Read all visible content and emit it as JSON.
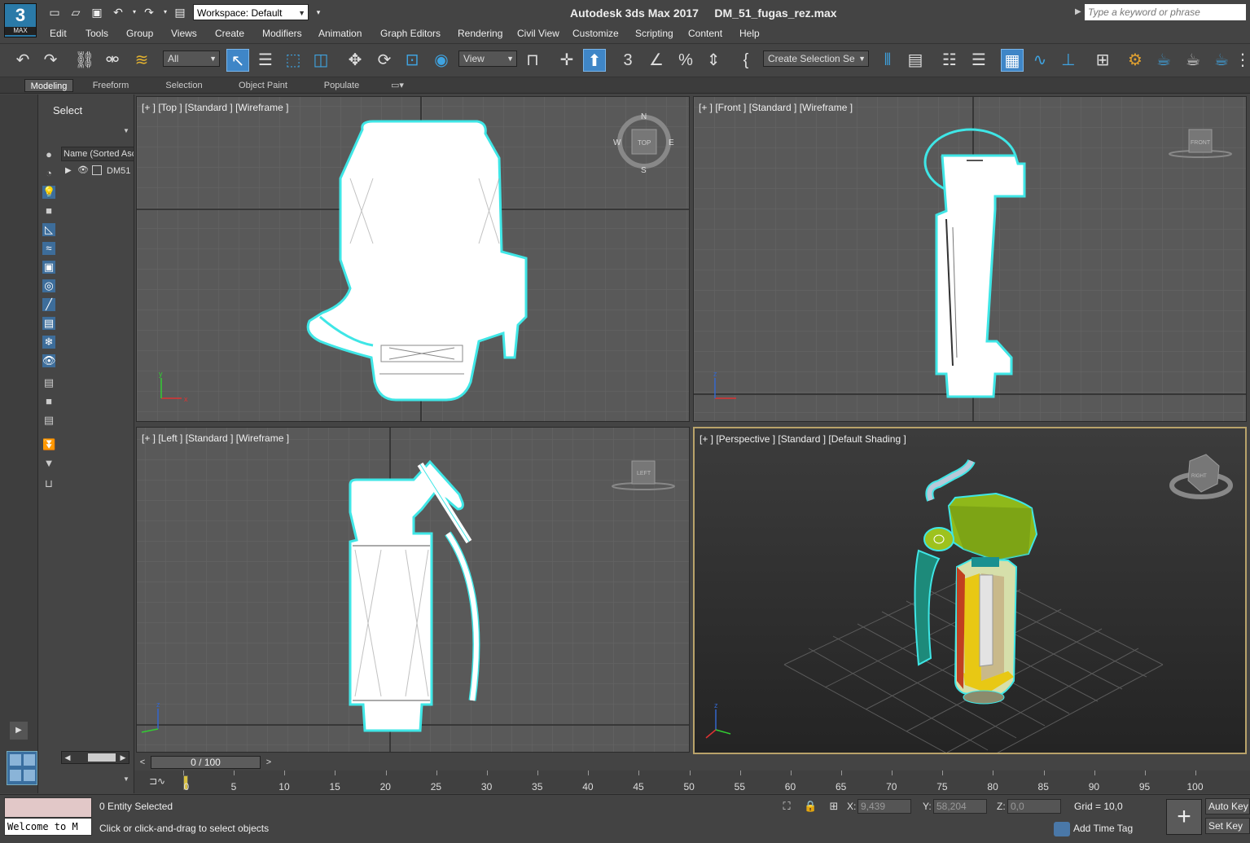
{
  "app": {
    "logo_number": "3",
    "logo_caption": "MAX",
    "title": "Autodesk 3ds Max 2017     DM_51_fugas_rez.max",
    "workspace": "Workspace: Default",
    "search_placeholder": "Type a keyword or phrase"
  },
  "menu": [
    "Edit",
    "Tools",
    "Group",
    "Views",
    "Create",
    "Modifiers",
    "Animation",
    "Graph Editors",
    "Rendering",
    "Civil View",
    "Customize",
    "Scripting",
    "Content",
    "Help"
  ],
  "toolbar": {
    "filter": "All",
    "reference_coord": "View",
    "selection_set": "Create Selection Se"
  },
  "ribbon_tabs": [
    "Modeling",
    "Freeform",
    "Selection",
    "Object Paint",
    "Populate"
  ],
  "explorer": {
    "title": "Select",
    "column_header": "Name (Sorted Asc",
    "row": "DM51"
  },
  "viewports": {
    "top": "[+ ] [Top ] [Standard ] [Wireframe ]",
    "front": "[+ ] [Front ] [Standard ] [Wireframe ]",
    "left": "[+ ] [Left ] [Standard ] [Wireframe ]",
    "perspective": "[+ ] [Perspective ] [Standard ] [Default Shading ]",
    "compass_n": "N",
    "compass_s": "S",
    "compass_w": "W",
    "compass_e": "E",
    "cube_top": "TOP",
    "cube_front": "FRONT",
    "cube_left": "LEFT",
    "cube_right": "RIGHT"
  },
  "timeline": {
    "frame": "0 / 100",
    "ticks": [
      "0",
      "5",
      "10",
      "15",
      "20",
      "25",
      "30",
      "35",
      "40",
      "45",
      "50",
      "55",
      "60",
      "65",
      "70",
      "75",
      "80",
      "85",
      "90",
      "95",
      "100"
    ]
  },
  "status": {
    "maxscript": "Welcome to M",
    "entity": "0 Entity Selected",
    "prompt": "Click or click-and-drag to select objects",
    "x_label": "X:",
    "x_value": "9,439",
    "y_label": "Y:",
    "y_value": "58,204",
    "z_label": "Z:",
    "z_value": "0,0",
    "grid": "Grid = 10,0",
    "add_time_tag": "Add Time Tag",
    "auto_key": "Auto Key",
    "set_key": "Set Key"
  },
  "colors": {
    "selection_cyan": "#3fe6e6",
    "active_blue": "#3f86c7",
    "viewport_bg": "#595959"
  }
}
